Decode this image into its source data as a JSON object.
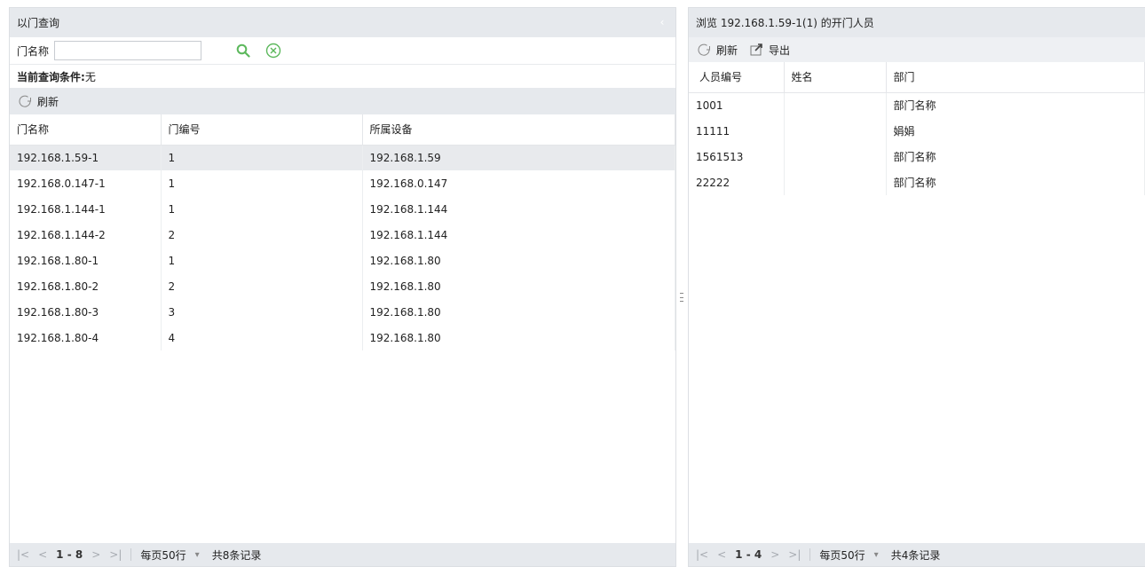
{
  "left": {
    "title": "以门查询",
    "collapse_glyph": "‹",
    "search": {
      "label": "门名称",
      "value": "",
      "placeholder": ""
    },
    "condition": {
      "label": "当前查询条件:",
      "value": " 无"
    },
    "toolbar": {
      "refresh_label": "刷新"
    },
    "columns": [
      "门名称",
      "门编号",
      "所属设备"
    ],
    "rows": [
      [
        "192.168.1.59-1",
        "1",
        "192.168.1.59"
      ],
      [
        "192.168.0.147-1",
        "1",
        "192.168.0.147"
      ],
      [
        "192.168.1.144-1",
        "1",
        "192.168.1.144"
      ],
      [
        "192.168.1.144-2",
        "2",
        "192.168.1.144"
      ],
      [
        "192.168.1.80-1",
        "1",
        "192.168.1.80"
      ],
      [
        "192.168.1.80-2",
        "2",
        "192.168.1.80"
      ],
      [
        "192.168.1.80-3",
        "3",
        "192.168.1.80"
      ],
      [
        "192.168.1.80-4",
        "4",
        "192.168.1.80"
      ]
    ],
    "pager": {
      "first": "|<",
      "prev": "<",
      "range": "1 - 8",
      "next": ">",
      "last": ">|",
      "page_size": "每页50行",
      "caret": "▾",
      "total": "共8条记录"
    }
  },
  "right": {
    "title": "浏览 192.168.1.59-1(1) 的开门人员",
    "toolbar": {
      "refresh_label": "刷新",
      "export_label": "导出"
    },
    "columns": [
      "人员编号",
      "姓名",
      "部门"
    ],
    "rows": [
      [
        "1001",
        "",
        "部门名称"
      ],
      [
        "11111",
        "",
        "娟娟"
      ],
      [
        "1561513",
        "",
        "部门名称"
      ],
      [
        "22222",
        "",
        "部门名称"
      ]
    ],
    "pager": {
      "first": "|<",
      "prev": "<",
      "range": "1 - 4",
      "next": ">",
      "last": ">|",
      "page_size": "每页50行",
      "caret": "▾",
      "total": "共4条记录"
    }
  },
  "colors": {
    "header_bg": "#e6e9ed",
    "search_icon": "#5cb85c",
    "clear_icon": "#5cb85c",
    "selected_row": "#e8eaed"
  },
  "icons": {
    "search": "search-icon",
    "clear": "clear-circle-icon",
    "refresh": "refresh-icon",
    "export": "export-icon"
  }
}
